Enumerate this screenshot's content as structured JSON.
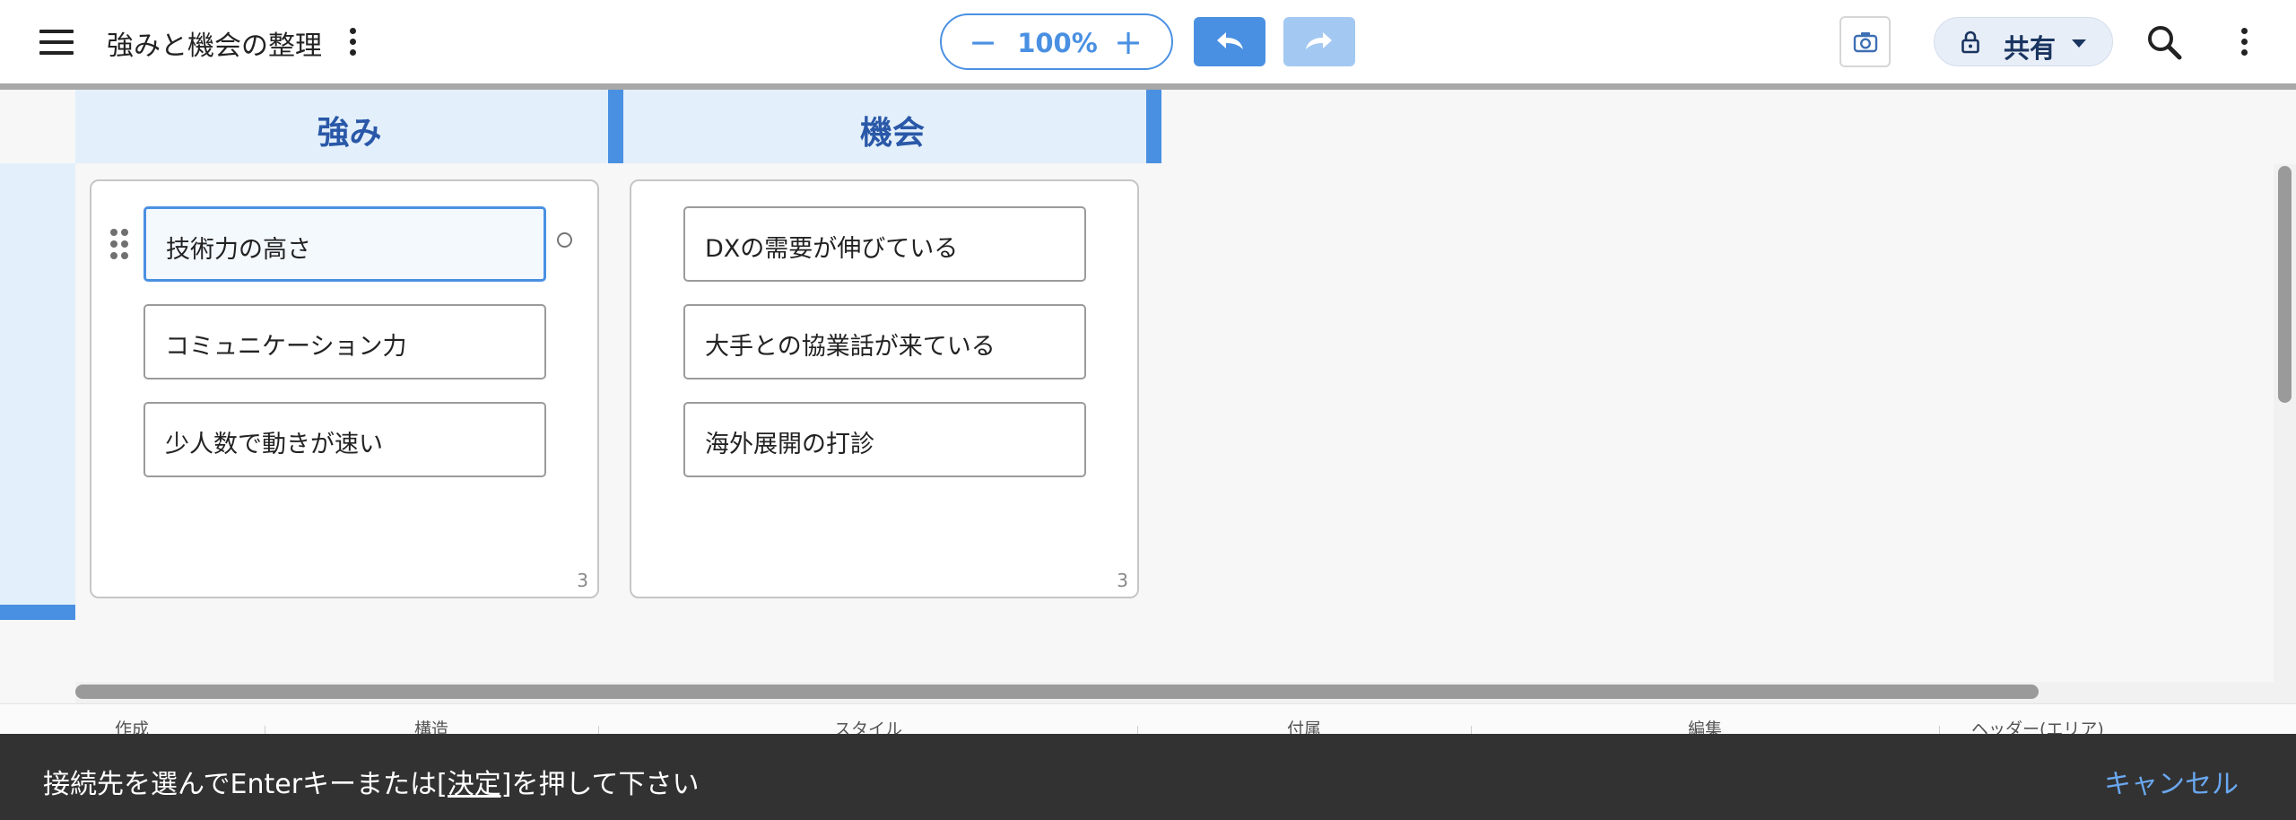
{
  "toolbar": {
    "title": "強みと機会の整理",
    "zoom_minus": "−",
    "zoom_level": "100%",
    "zoom_plus": "+",
    "share_label": "共有"
  },
  "board": {
    "columns": [
      {
        "title": "強み",
        "cards": [
          "技術力の高さ",
          "コミュニケーション力",
          "少人数で動きが速い"
        ],
        "count": "3"
      },
      {
        "title": "機会",
        "cards": [
          "DXの需要が伸びている",
          "大手との協業話が来ている",
          "海外展開の打診"
        ],
        "count": "3"
      }
    ],
    "selected_card": "技術力の高さ"
  },
  "tabs": [
    "作成",
    "構造",
    "スタイル",
    "付属",
    "編集",
    "ヘッダー(エリア)"
  ],
  "snackbar": {
    "message_before": "接続先を選んでEnterキーまたは",
    "message_link": "[決定]",
    "message_after": "を押して下さい",
    "cancel_label": "キャンセル"
  },
  "colors": {
    "accent": "#4a90e2",
    "header_bg": "#e3f0fb",
    "header_text": "#2a58a8",
    "snackbar_bg": "#323232",
    "snackbar_action": "#6aa8f0"
  },
  "icons": [
    "menu-icon",
    "more-vert-icon",
    "undo-icon",
    "redo-icon",
    "camera-icon",
    "lock-icon",
    "search-icon",
    "drag-handle-icon"
  ]
}
